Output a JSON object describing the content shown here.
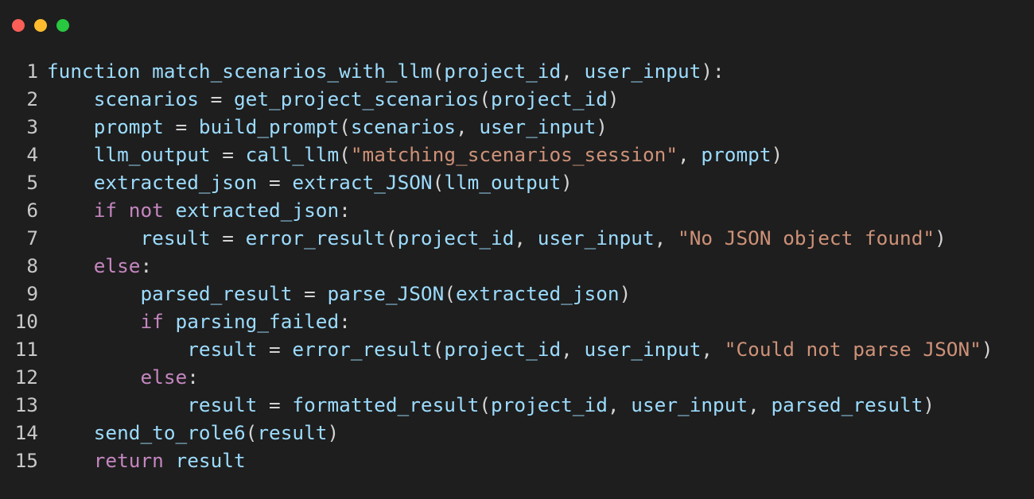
{
  "window": {
    "controls": [
      {
        "name": "close",
        "color": "#ff5f57"
      },
      {
        "name": "minimize",
        "color": "#febc2e"
      },
      {
        "name": "maximize",
        "color": "#28c840"
      }
    ]
  },
  "colors": {
    "background": "#1e1e1e",
    "line_number": "#c8c8c8",
    "identifier": "#9cdcfe",
    "keyword": "#c586c0",
    "string": "#ce9178",
    "punctuation": "#d4d4d4"
  },
  "code": {
    "lines": [
      {
        "number": "1",
        "indent": 0,
        "tokens": [
          {
            "t": "function match_scenarios_with_llm",
            "k": "ident"
          },
          {
            "t": "(",
            "k": "punct"
          },
          {
            "t": "project_id",
            "k": "ident"
          },
          {
            "t": ", ",
            "k": "punct"
          },
          {
            "t": "user_input",
            "k": "ident"
          },
          {
            "t": "):",
            "k": "punct"
          }
        ]
      },
      {
        "number": "2",
        "indent": 1,
        "tokens": [
          {
            "t": "scenarios",
            "k": "ident"
          },
          {
            "t": " = ",
            "k": "punct"
          },
          {
            "t": "get_project_scenarios",
            "k": "ident"
          },
          {
            "t": "(",
            "k": "punct"
          },
          {
            "t": "project_id",
            "k": "ident"
          },
          {
            "t": ")",
            "k": "punct"
          }
        ]
      },
      {
        "number": "3",
        "indent": 1,
        "tokens": [
          {
            "t": "prompt",
            "k": "ident"
          },
          {
            "t": " = ",
            "k": "punct"
          },
          {
            "t": "build_prompt",
            "k": "ident"
          },
          {
            "t": "(",
            "k": "punct"
          },
          {
            "t": "scenarios",
            "k": "ident"
          },
          {
            "t": ", ",
            "k": "punct"
          },
          {
            "t": "user_input",
            "k": "ident"
          },
          {
            "t": ")",
            "k": "punct"
          }
        ]
      },
      {
        "number": "4",
        "indent": 1,
        "tokens": [
          {
            "t": "llm_output",
            "k": "ident"
          },
          {
            "t": " = ",
            "k": "punct"
          },
          {
            "t": "call_llm",
            "k": "ident"
          },
          {
            "t": "(",
            "k": "punct"
          },
          {
            "t": "\"matching_scenarios_session\"",
            "k": "str"
          },
          {
            "t": ", ",
            "k": "punct"
          },
          {
            "t": "prompt",
            "k": "ident"
          },
          {
            "t": ")",
            "k": "punct"
          }
        ]
      },
      {
        "number": "5",
        "indent": 1,
        "tokens": [
          {
            "t": "extracted_json",
            "k": "ident"
          },
          {
            "t": " = ",
            "k": "punct"
          },
          {
            "t": "extract_JSON",
            "k": "ident"
          },
          {
            "t": "(",
            "k": "punct"
          },
          {
            "t": "llm_output",
            "k": "ident"
          },
          {
            "t": ")",
            "k": "punct"
          }
        ]
      },
      {
        "number": "6",
        "indent": 1,
        "tokens": [
          {
            "t": "if not",
            "k": "kw"
          },
          {
            "t": " ",
            "k": "punct"
          },
          {
            "t": "extracted_json",
            "k": "ident"
          },
          {
            "t": ":",
            "k": "punct"
          }
        ]
      },
      {
        "number": "7",
        "indent": 2,
        "tokens": [
          {
            "t": "result",
            "k": "ident"
          },
          {
            "t": " = ",
            "k": "punct"
          },
          {
            "t": "error_result",
            "k": "ident"
          },
          {
            "t": "(",
            "k": "punct"
          },
          {
            "t": "project_id",
            "k": "ident"
          },
          {
            "t": ", ",
            "k": "punct"
          },
          {
            "t": "user_input",
            "k": "ident"
          },
          {
            "t": ", ",
            "k": "punct"
          },
          {
            "t": "\"No JSON object found\"",
            "k": "str"
          },
          {
            "t": ")",
            "k": "punct"
          }
        ]
      },
      {
        "number": "8",
        "indent": 1,
        "tokens": [
          {
            "t": "else",
            "k": "kw"
          },
          {
            "t": ":",
            "k": "punct"
          }
        ]
      },
      {
        "number": "9",
        "indent": 2,
        "tokens": [
          {
            "t": "parsed_result",
            "k": "ident"
          },
          {
            "t": " = ",
            "k": "punct"
          },
          {
            "t": "parse_JSON",
            "k": "ident"
          },
          {
            "t": "(",
            "k": "punct"
          },
          {
            "t": "extracted_json",
            "k": "ident"
          },
          {
            "t": ")",
            "k": "punct"
          }
        ]
      },
      {
        "number": "10",
        "indent": 2,
        "tokens": [
          {
            "t": "if",
            "k": "kw"
          },
          {
            "t": " ",
            "k": "punct"
          },
          {
            "t": "parsing_failed",
            "k": "ident"
          },
          {
            "t": ":",
            "k": "punct"
          }
        ]
      },
      {
        "number": "11",
        "indent": 3,
        "tokens": [
          {
            "t": "result",
            "k": "ident"
          },
          {
            "t": " = ",
            "k": "punct"
          },
          {
            "t": "error_result",
            "k": "ident"
          },
          {
            "t": "(",
            "k": "punct"
          },
          {
            "t": "project_id",
            "k": "ident"
          },
          {
            "t": ", ",
            "k": "punct"
          },
          {
            "t": "user_input",
            "k": "ident"
          },
          {
            "t": ", ",
            "k": "punct"
          },
          {
            "t": "\"Could not parse JSON\"",
            "k": "str"
          },
          {
            "t": ")",
            "k": "punct"
          }
        ]
      },
      {
        "number": "12",
        "indent": 2,
        "tokens": [
          {
            "t": "else",
            "k": "kw"
          },
          {
            "t": ":",
            "k": "punct"
          }
        ]
      },
      {
        "number": "13",
        "indent": 3,
        "tokens": [
          {
            "t": "result",
            "k": "ident"
          },
          {
            "t": " = ",
            "k": "punct"
          },
          {
            "t": "formatted_result",
            "k": "ident"
          },
          {
            "t": "(",
            "k": "punct"
          },
          {
            "t": "project_id",
            "k": "ident"
          },
          {
            "t": ", ",
            "k": "punct"
          },
          {
            "t": "user_input",
            "k": "ident"
          },
          {
            "t": ", ",
            "k": "punct"
          },
          {
            "t": "parsed_result",
            "k": "ident"
          },
          {
            "t": ")",
            "k": "punct"
          }
        ]
      },
      {
        "number": "14",
        "indent": 1,
        "tokens": [
          {
            "t": "send_to_role6",
            "k": "ident"
          },
          {
            "t": "(",
            "k": "punct"
          },
          {
            "t": "result",
            "k": "ident"
          },
          {
            "t": ")",
            "k": "punct"
          }
        ]
      },
      {
        "number": "15",
        "indent": 1,
        "tokens": [
          {
            "t": "return",
            "k": "kw"
          },
          {
            "t": " ",
            "k": "punct"
          },
          {
            "t": "result",
            "k": "ident"
          }
        ]
      }
    ]
  }
}
